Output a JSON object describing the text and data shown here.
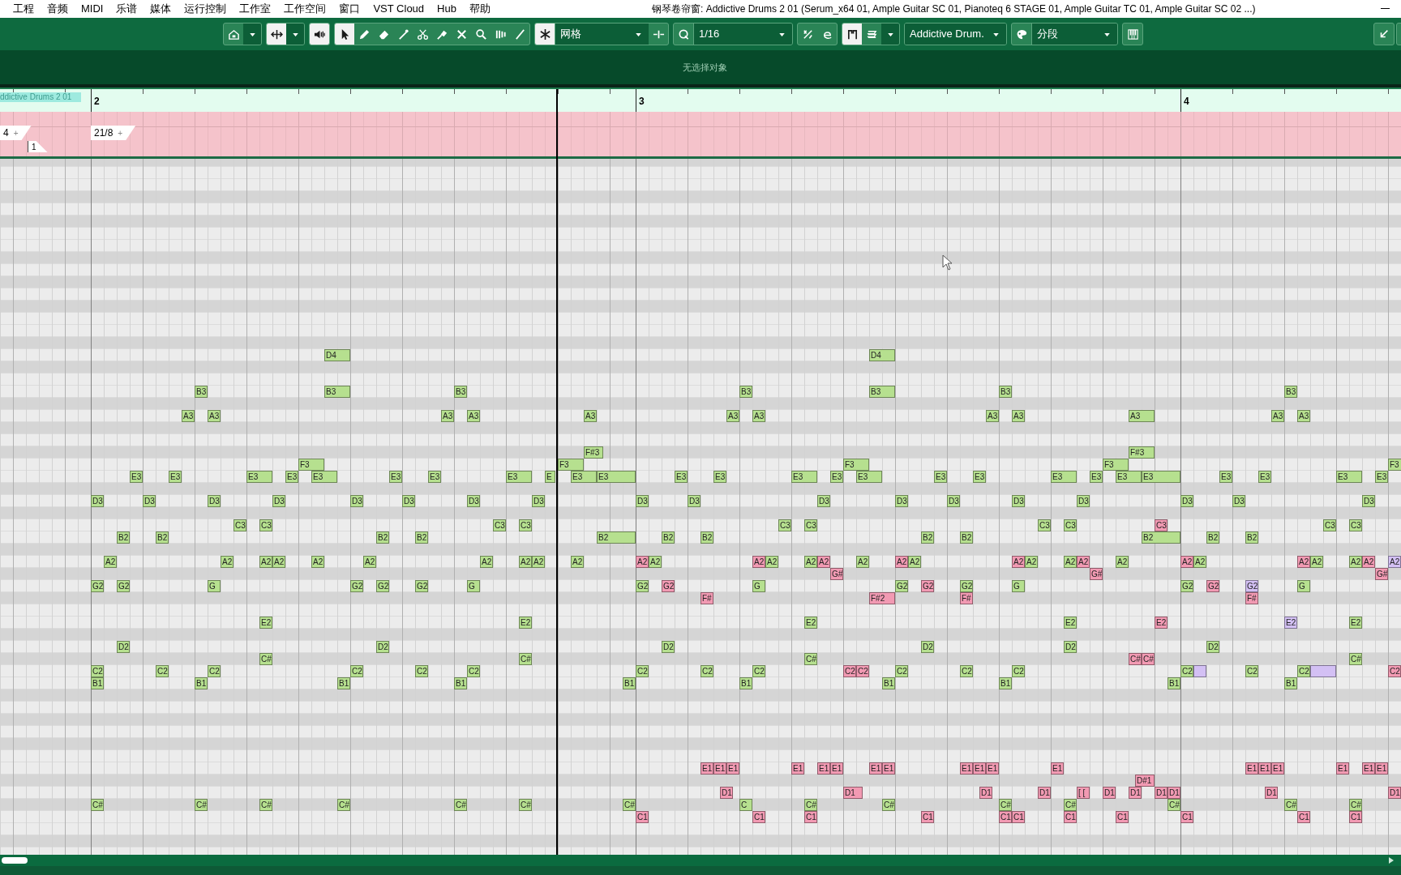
{
  "menu": [
    "工程",
    "音频",
    "MIDI",
    "乐谱",
    "媒体",
    "运行控制",
    "工作室",
    "工作空间",
    "窗口",
    "VST Cloud",
    "Hub",
    "帮助"
  ],
  "window_title": "钢琴卷帘窗: Addictive Drums 2 01 (Serum_x64 01, Ample Guitar SC 01, Pianoteq 6 STAGE 01, Ample Guitar TC 01, Ample Guitar SC 02 ...)",
  "toolbar": [
    [
      {
        "kind": "home",
        "selected": false
      },
      {
        "kind": "caret"
      }
    ],
    [
      {
        "kind": "autoscroll",
        "selected": true
      },
      {
        "kind": "caret"
      }
    ],
    [
      {
        "kind": "speaker",
        "selected": true
      }
    ],
    [
      {
        "kind": "pointer",
        "selected": true
      },
      {
        "kind": "pencil",
        "selected": false
      },
      {
        "kind": "eraser",
        "selected": false
      },
      {
        "kind": "brush",
        "selected": false
      },
      {
        "kind": "scissors",
        "selected": false
      },
      {
        "kind": "glue",
        "selected": false
      },
      {
        "kind": "mute",
        "selected": false
      },
      {
        "kind": "zoom",
        "selected": false
      },
      {
        "kind": "comp",
        "selected": false
      },
      {
        "kind": "line",
        "selected": false
      }
    ],
    [
      {
        "kind": "snap",
        "selected": true
      },
      {
        "kind": "dropdown",
        "label": "网格"
      },
      {
        "kind": "trim",
        "selected": false
      }
    ],
    [
      {
        "kind": "quantize",
        "selected": false
      },
      {
        "kind": "dropdown",
        "label": "1/16"
      }
    ],
    [
      {
        "kind": "fraction",
        "selected": false
      },
      {
        "kind": "curl",
        "selected": false
      }
    ],
    [
      {
        "kind": "bracket",
        "selected": true
      },
      {
        "kind": "stack",
        "selected": false
      },
      {
        "kind": "caret"
      }
    ],
    [
      {
        "kind": "dropdown",
        "label": "Addictive Drum."
      }
    ],
    [
      {
        "kind": "palette",
        "selected": false
      },
      {
        "kind": "dropdown",
        "label": "分段"
      }
    ],
    [
      {
        "kind": "piano",
        "selected": false
      }
    ]
  ],
  "info_line": "无选择对象",
  "ruler": {
    "part_label": "ddictive Drums 2 01",
    "bars": [
      "2",
      "3",
      "4"
    ]
  },
  "signature_track": {
    "markers": [
      {
        "label": "4",
        "handle": "+",
        "kind": "signature"
      },
      {
        "label": "21/8",
        "handle": "+",
        "kind": "signature"
      },
      {
        "label": "1",
        "kind": "marker"
      }
    ]
  },
  "notes": [
    {
      "label": "D4",
      "color": "#b6e08f"
    },
    {
      "label": "D4",
      "color": "#b6e08f"
    },
    {
      "label": "B3",
      "color": "#b6e08f"
    },
    {
      "label": "B3",
      "color": "#b6e08f"
    },
    {
      "label": "B3",
      "color": "#b6e08f"
    },
    {
      "label": "B3",
      "color": "#b6e08f"
    },
    {
      "label": "B3",
      "color": "#b6e08f"
    },
    {
      "label": "B3",
      "color": "#b6e08f"
    },
    {
      "label": "B3",
      "color": "#b6e08f"
    },
    {
      "label": "A3",
      "color": "#b6e08f"
    },
    {
      "label": "A3",
      "color": "#b6e08f"
    },
    {
      "label": "A3",
      "color": "#b6e08f"
    },
    {
      "label": "A3",
      "color": "#b6e08f"
    },
    {
      "label": "A3",
      "color": "#b6e08f"
    },
    {
      "label": "A3",
      "color": "#b6e08f"
    },
    {
      "label": "A3",
      "color": "#b6e08f"
    },
    {
      "label": "A3",
      "color": "#b6e08f"
    },
    {
      "label": "A3",
      "color": "#b6e08f"
    },
    {
      "label": "A3",
      "color": "#b6e08f"
    },
    {
      "label": "A3",
      "color": "#b6e08f"
    },
    {
      "label": "A3",
      "color": "#b6e08f"
    },
    {
      "label": "F#3",
      "color": "#b6e08f"
    },
    {
      "label": "F#3",
      "color": "#b6e08f"
    },
    {
      "label": "F3",
      "color": "#b6e08f"
    },
    {
      "label": "F3",
      "color": "#b6e08f"
    },
    {
      "label": "F3",
      "color": "#b6e08f"
    },
    {
      "label": "F3",
      "color": "#b6e08f"
    },
    {
      "label": "F3",
      "color": "#b6e08f"
    },
    {
      "label": "E3",
      "color": "#b6e08f"
    },
    {
      "label": "E3",
      "color": "#b6e08f"
    },
    {
      "label": "E3",
      "color": "#b6e08f"
    },
    {
      "label": "E3",
      "color": "#b6e08f"
    },
    {
      "label": "E3",
      "color": "#b6e08f"
    },
    {
      "label": "E3",
      "color": "#b6e08f"
    },
    {
      "label": "E3",
      "color": "#b6e08f"
    },
    {
      "label": "E3",
      "color": "#b6e08f"
    },
    {
      "label": "E",
      "color": "#b6e08f"
    },
    {
      "label": "E3",
      "color": "#b6e08f"
    },
    {
      "label": "E3",
      "color": "#b6e08f"
    },
    {
      "label": "E3",
      "color": "#b6e08f"
    },
    {
      "label": "E3",
      "color": "#b6e08f"
    },
    {
      "label": "E3",
      "color": "#b6e08f"
    },
    {
      "label": "E3",
      "color": "#b6e08f"
    },
    {
      "label": "E3",
      "color": "#b6e08f"
    },
    {
      "label": "E3",
      "color": "#b6e08f"
    },
    {
      "label": "E3",
      "color": "#b6e08f"
    },
    {
      "label": "E3",
      "color": "#b6e08f"
    },
    {
      "label": "E3",
      "color": "#b6e08f"
    },
    {
      "label": "E3",
      "color": "#b6e08f"
    },
    {
      "label": "E3",
      "color": "#b6e08f"
    },
    {
      "label": "E3",
      "color": "#b6e08f"
    },
    {
      "label": "E3",
      "color": "#b6e08f"
    },
    {
      "label": "E3",
      "color": "#b6e08f"
    },
    {
      "label": "E3",
      "color": "#b6e08f"
    },
    {
      "label": "D3",
      "color": "#b6e08f"
    },
    {
      "label": "D3",
      "color": "#b6e08f"
    },
    {
      "label": "D3",
      "color": "#b6e08f"
    },
    {
      "label": "D3",
      "color": "#b6e08f"
    },
    {
      "label": "D3",
      "color": "#b6e08f"
    },
    {
      "label": "D3",
      "color": "#b6e08f"
    },
    {
      "label": "D3",
      "color": "#b6e08f"
    },
    {
      "label": "D3",
      "color": "#b6e08f"
    },
    {
      "label": "D3",
      "color": "#b6e08f"
    },
    {
      "label": "D3",
      "color": "#b6e08f"
    },
    {
      "label": "D3",
      "color": "#b6e08f"
    },
    {
      "label": "D3",
      "color": "#b6e08f"
    },
    {
      "label": "D3",
      "color": "#b6e08f"
    },
    {
      "label": "D3",
      "color": "#b6e08f"
    },
    {
      "label": "D3",
      "color": "#b6e08f"
    },
    {
      "label": "D3",
      "color": "#b6e08f"
    },
    {
      "label": "D3",
      "color": "#b6e08f"
    },
    {
      "label": "D3",
      "color": "#b6e08f"
    },
    {
      "label": "C3",
      "color": "#b6e08f"
    },
    {
      "label": "C3",
      "color": "#b6e08f"
    },
    {
      "label": "C3",
      "color": "#b6e08f"
    },
    {
      "label": "C3",
      "color": "#b6e08f"
    },
    {
      "label": "C3",
      "color": "#b6e08f"
    },
    {
      "label": "C3",
      "color": "#b6e08f"
    },
    {
      "label": "C3",
      "color": "#b6e08f"
    },
    {
      "label": "C3",
      "color": "#b6e08f"
    },
    {
      "label": "C3",
      "color": "#f29ab3"
    },
    {
      "label": "C3",
      "color": "#b6e08f"
    },
    {
      "label": "C3",
      "color": "#b6e08f"
    },
    {
      "label": "B2",
      "color": "#b6e08f"
    },
    {
      "label": "B2",
      "color": "#b6e08f"
    },
    {
      "label": "B2",
      "color": "#b6e08f"
    },
    {
      "label": "B2",
      "color": "#b6e08f"
    },
    {
      "label": "B2",
      "color": "#b6e08f"
    },
    {
      "label": "B2",
      "color": "#b6e08f"
    },
    {
      "label": "B2",
      "color": "#b6e08f"
    },
    {
      "label": "B2",
      "color": "#b6e08f"
    },
    {
      "label": "B2",
      "color": "#b6e08f"
    },
    {
      "label": "B2",
      "color": "#b6e08f"
    },
    {
      "label": "B2",
      "color": "#b6e08f"
    },
    {
      "label": "B2",
      "color": "#b6e08f"
    },
    {
      "label": "A2",
      "color": "#b6e08f"
    },
    {
      "label": "A2",
      "color": "#b6e08f"
    },
    {
      "label": "A2",
      "color": "#b6e08f"
    },
    {
      "label": "A2",
      "color": "#b6e08f"
    },
    {
      "label": "A2",
      "color": "#b6e08f"
    },
    {
      "label": "A2",
      "color": "#b6e08f"
    },
    {
      "label": "A2",
      "color": "#b6e08f"
    },
    {
      "label": "A2",
      "color": "#b6e08f"
    },
    {
      "label": "A2",
      "color": "#b6e08f"
    },
    {
      "label": "A2",
      "color": "#b6e08f"
    },
    {
      "label": "A2",
      "color": "#f29ab3"
    },
    {
      "label": "A2",
      "color": "#b6e08f"
    },
    {
      "label": "A2",
      "color": "#f29ab3"
    },
    {
      "label": "A2",
      "color": "#b6e08f"
    },
    {
      "label": "A2",
      "color": "#b6e08f"
    },
    {
      "label": "A2",
      "color": "#f29ab3"
    },
    {
      "label": "A2",
      "color": "#b6e08f"
    },
    {
      "label": "A2",
      "color": "#f29ab3"
    },
    {
      "label": "A2",
      "color": "#b6e08f"
    },
    {
      "label": "A2",
      "color": "#f29ab3"
    },
    {
      "label": "A2",
      "color": "#b6e08f"
    },
    {
      "label": "A2",
      "color": "#b6e08f"
    },
    {
      "label": "A2",
      "color": "#f29ab3"
    },
    {
      "label": "A2",
      "color": "#b6e08f"
    },
    {
      "label": "A2",
      "color": "#f29ab3"
    },
    {
      "label": "A2",
      "color": "#b6e08f"
    },
    {
      "label": "A2",
      "color": "#f29ab3"
    },
    {
      "label": "A2",
      "color": "#b6e08f"
    },
    {
      "label": "A2",
      "color": "#b6e08f"
    },
    {
      "label": "A2",
      "color": "#f29ab3"
    },
    {
      "label": "A2",
      "color": "#d3c0f4"
    },
    {
      "label": "G#",
      "color": "#f29ab3"
    },
    {
      "label": "G#",
      "color": "#f29ab3"
    },
    {
      "label": "G#",
      "color": "#f29ab3"
    },
    {
      "label": "G2",
      "color": "#b6e08f"
    },
    {
      "label": "G2",
      "color": "#b6e08f"
    },
    {
      "label": "G",
      "color": "#b6e08f"
    },
    {
      "label": "G2",
      "color": "#b6e08f"
    },
    {
      "label": "G2",
      "color": "#b6e08f"
    },
    {
      "label": "G2",
      "color": "#b6e08f"
    },
    {
      "label": "G",
      "color": "#b6e08f"
    },
    {
      "label": "G2",
      "color": "#b6e08f"
    },
    {
      "label": "G2",
      "color": "#f29ab3"
    },
    {
      "label": "G",
      "color": "#b6e08f"
    },
    {
      "label": "G2",
      "color": "#b6e08f"
    },
    {
      "label": "G2",
      "color": "#f29ab3"
    },
    {
      "label": "G2",
      "color": "#b6e08f"
    },
    {
      "label": "G",
      "color": "#b6e08f"
    },
    {
      "label": "G2",
      "color": "#b6e08f"
    },
    {
      "label": "G2",
      "color": "#f29ab3"
    },
    {
      "label": "G2",
      "color": "#d3c0f4"
    },
    {
      "label": "G",
      "color": "#b6e08f"
    },
    {
      "label": "F#",
      "color": "#f29ab3"
    },
    {
      "label": "F#2",
      "color": "#f29ab3"
    },
    {
      "label": "F#",
      "color": "#f29ab3"
    },
    {
      "label": "F#",
      "color": "#f29ab3"
    },
    {
      "label": "E2",
      "color": "#b6e08f"
    },
    {
      "label": "E2",
      "color": "#b6e08f"
    },
    {
      "label": "E2",
      "color": "#b6e08f"
    },
    {
      "label": "E2",
      "color": "#b6e08f"
    },
    {
      "label": "E2",
      "color": "#f29ab3"
    },
    {
      "label": "E2",
      "color": "#d3c0f4"
    },
    {
      "label": "E2",
      "color": "#b6e08f"
    },
    {
      "label": "D2",
      "color": "#b6e08f"
    },
    {
      "label": "D2",
      "color": "#b6e08f"
    },
    {
      "label": "D2",
      "color": "#b6e08f"
    },
    {
      "label": "D2",
      "color": "#b6e08f"
    },
    {
      "label": "D2",
      "color": "#b6e08f"
    },
    {
      "label": "D2",
      "color": "#b6e08f"
    },
    {
      "label": "C#",
      "color": "#b6e08f"
    },
    {
      "label": "C#",
      "color": "#b6e08f"
    },
    {
      "label": "C#",
      "color": "#b6e08f"
    },
    {
      "label": "C#",
      "color": "#f29ab3"
    },
    {
      "label": "C#",
      "color": "#f29ab3"
    },
    {
      "label": "C#",
      "color": "#b6e08f"
    },
    {
      "label": "C2",
      "color": "#b6e08f"
    },
    {
      "label": "C2",
      "color": "#b6e08f"
    },
    {
      "label": "C2",
      "color": "#b6e08f"
    },
    {
      "label": "C2",
      "color": "#b6e08f"
    },
    {
      "label": "C2",
      "color": "#b6e08f"
    },
    {
      "label": "C2",
      "color": "#b6e08f"
    },
    {
      "label": "C2",
      "color": "#b6e08f"
    },
    {
      "label": "C2",
      "color": "#b6e08f"
    },
    {
      "label": "C2",
      "color": "#b6e08f"
    },
    {
      "label": "C2",
      "color": "#f29ab3"
    },
    {
      "label": "C2",
      "color": "#f29ab3"
    },
    {
      "label": "C2",
      "color": "#b6e08f"
    },
    {
      "label": "C2",
      "color": "#b6e08f"
    },
    {
      "label": "C2",
      "color": "#b6e08f"
    },
    {
      "label": "C2",
      "color": "#b6e08f"
    },
    {
      "color": "#d3c0f4"
    },
    {
      "label": "C2",
      "color": "#b6e08f"
    },
    {
      "label": "C2",
      "color": "#b6e08f"
    },
    {
      "color": "#d3c0f4"
    },
    {
      "label": "C2",
      "color": "#f29ab3"
    },
    {
      "label": "B1",
      "color": "#b6e08f"
    },
    {
      "label": "B1",
      "color": "#b6e08f"
    },
    {
      "label": "B1",
      "color": "#b6e08f"
    },
    {
      "label": "B1",
      "color": "#b6e08f"
    },
    {
      "label": "B1",
      "color": "#b6e08f"
    },
    {
      "label": "B1",
      "color": "#b6e08f"
    },
    {
      "label": "B1",
      "color": "#b6e08f"
    },
    {
      "label": "B1",
      "color": "#b6e08f"
    },
    {
      "label": "B1",
      "color": "#b6e08f"
    },
    {
      "label": "B1",
      "color": "#b6e08f"
    },
    {
      "label": "E1",
      "color": "#f29ab3"
    },
    {
      "label": "E1",
      "color": "#f29ab3"
    },
    {
      "label": "E1",
      "color": "#f29ab3"
    },
    {
      "label": "E1",
      "color": "#f29ab3"
    },
    {
      "label": "E1",
      "color": "#f29ab3"
    },
    {
      "label": "E1",
      "color": "#f29ab3"
    },
    {
      "label": "E1",
      "color": "#f29ab3"
    },
    {
      "label": "E1",
      "color": "#f29ab3"
    },
    {
      "label": "E1",
      "color": "#f29ab3"
    },
    {
      "label": "E1",
      "color": "#f29ab3"
    },
    {
      "label": "E1",
      "color": "#f29ab3"
    },
    {
      "label": "E1",
      "color": "#f29ab3"
    },
    {
      "label": "E1",
      "color": "#f29ab3"
    },
    {
      "label": "E1",
      "color": "#f29ab3"
    },
    {
      "label": "E1",
      "color": "#f29ab3"
    },
    {
      "label": "E1",
      "color": "#f29ab3"
    },
    {
      "label": "E1",
      "color": "#f29ab3"
    },
    {
      "label": "E1",
      "color": "#f29ab3"
    },
    {
      "label": "D#1",
      "color": "#f29ab3"
    },
    {
      "label": "D1",
      "color": "#f29ab3"
    },
    {
      "label": "D1",
      "color": "#f29ab3"
    },
    {
      "label": "D1",
      "color": "#f29ab3"
    },
    {
      "label": "D1",
      "color": "#f29ab3"
    },
    {
      "label": "[ [",
      "color": "#f29ab3"
    },
    {
      "label": "D1",
      "color": "#f29ab3"
    },
    {
      "label": "D1",
      "color": "#f29ab3"
    },
    {
      "label": "D1",
      "color": "#f29ab3"
    },
    {
      "label": "D1",
      "color": "#f29ab3"
    },
    {
      "label": "D1",
      "color": "#f29ab3"
    },
    {
      "label": "D1",
      "color": "#f29ab3"
    },
    {
      "label": "C#",
      "color": "#b6e08f"
    },
    {
      "label": "C#",
      "color": "#b6e08f"
    },
    {
      "label": "C#",
      "color": "#b6e08f"
    },
    {
      "label": "C#",
      "color": "#b6e08f"
    },
    {
      "label": "C#",
      "color": "#b6e08f"
    },
    {
      "label": "C#",
      "color": "#b6e08f"
    },
    {
      "label": "C#",
      "color": "#b6e08f"
    },
    {
      "label": "C",
      "color": "#b6e08f"
    },
    {
      "label": "C#",
      "color": "#b6e08f"
    },
    {
      "label": "C#",
      "color": "#b6e08f"
    },
    {
      "label": "C#",
      "color": "#b6e08f"
    },
    {
      "label": "C#",
      "color": "#b6e08f"
    },
    {
      "label": "C#",
      "color": "#b6e08f"
    },
    {
      "label": "C#",
      "color": "#b6e08f"
    },
    {
      "label": "C#",
      "color": "#b6e08f"
    },
    {
      "label": "C1",
      "color": "#f29ab3"
    },
    {
      "label": "C1",
      "color": "#f29ab3"
    },
    {
      "label": "C1",
      "color": "#f29ab3"
    },
    {
      "label": "C1",
      "color": "#f29ab3"
    },
    {
      "label": "C1",
      "color": "#f29ab3"
    },
    {
      "label": "C1",
      "color": "#f29ab3"
    },
    {
      "label": "C1",
      "color": "#f29ab3"
    },
    {
      "label": "C1",
      "color": "#f29ab3"
    },
    {
      "label": "C1",
      "color": "#f29ab3"
    },
    {
      "label": "C1",
      "color": "#f29ab3"
    },
    {
      "label": "C1",
      "color": "#f29ab3"
    }
  ]
}
